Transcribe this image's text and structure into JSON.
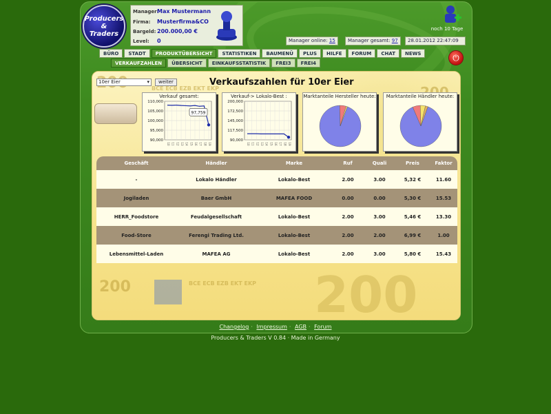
{
  "logo": {
    "line1": "Producers",
    "line2": "&",
    "line3": "Traders"
  },
  "manager": {
    "label_manager": "Manager:",
    "manager": "Max Mustermann",
    "label_firma": "Firma:",
    "firma": "Musterfirma&CO",
    "label_bargeld": "Bargeld:",
    "bargeld": "200.000,00 €",
    "label_level": "Level:",
    "level": "0"
  },
  "stats": {
    "online_label": "Manager online:",
    "online": "15",
    "total_label": "Manager gesamt:",
    "total": "97",
    "datetime": "28.01.2012 22:47:09"
  },
  "reward": {
    "label": "noch 10 Tage"
  },
  "nav": [
    "BÜRO",
    "STADT",
    "PRODUKTÜBERSICHT",
    "STATISTIKEN",
    "BAUMENÜ",
    "PLUS",
    "HILFE",
    "FORUM",
    "CHAT",
    "NEWS"
  ],
  "nav_active": 2,
  "subnav": [
    "VERKAUFZAHLEN",
    "ÜBERSICHT",
    "EINKAUFSSTATISTIK",
    "FREI3",
    "FREI4"
  ],
  "subnav_active": 0,
  "product_select": "10er Eier",
  "weiter": "weiter",
  "title": "Verkaufszahlen für 10er Eier",
  "banknote": {
    "denom": "200",
    "codes": "BCE ECB EZB EKT EKP"
  },
  "charts": {
    "c1_title": "Verkauf gesamt:",
    "c2_title": "Verkauf-> Lokalo-Best :",
    "c3_title": "Marktanteile Hersteller heute:",
    "c4_title": "Marktanteile Händler heute:",
    "tooltip": "97,759"
  },
  "chart_data": [
    {
      "type": "line",
      "title": "Verkauf gesamt:",
      "ylim": [
        90000,
        110000
      ],
      "yticks": [
        "110,000",
        "105,000",
        "100,000",
        "95,000",
        "90,000"
      ],
      "values": [
        108000,
        107900,
        108000,
        107800,
        107700,
        107600,
        107800,
        107400,
        107600,
        97759
      ],
      "x": [
        "10",
        "11",
        "12",
        "13",
        "14",
        "15",
        "16",
        "17",
        "18",
        "19"
      ]
    },
    {
      "type": "line",
      "title": "Verkauf-> Lokalo-Best :",
      "ylim": [
        90000,
        200000
      ],
      "yticks": [
        "200,000",
        "172,500",
        "145,000",
        "117,500",
        "90,000"
      ],
      "values": [
        107500,
        107500,
        107500,
        107000,
        107000,
        107000,
        107000,
        107000,
        107000,
        97500
      ],
      "x": [
        "10",
        "11",
        "12",
        "13",
        "14",
        "15",
        "16",
        "17",
        "18",
        "19"
      ]
    },
    {
      "type": "pie",
      "title": "Marktanteile Hersteller heute:",
      "values": [
        94,
        5,
        1
      ],
      "colors": [
        "#7f82e8",
        "#f07a7a",
        "#f5e26a"
      ]
    },
    {
      "type": "pie",
      "title": "Marktanteile Händler heute:",
      "values": [
        88,
        6,
        4,
        2
      ],
      "colors": [
        "#7f82e8",
        "#f07a7a",
        "#f5e26a",
        "#e0b060"
      ]
    }
  ],
  "table": {
    "headers": [
      "Geschäft",
      "Händler",
      "Marke",
      "Ruf",
      "Quali",
      "Preis",
      "Faktor"
    ],
    "rows": [
      [
        "-",
        "Lokalo Händler",
        "Lokalo-Best",
        "2.00",
        "3.00",
        "5,32 €",
        "11.60"
      ],
      [
        "Jogiladen",
        "Baer GmbH",
        "MAFEA FOOD",
        "0.00",
        "0.00",
        "5,30 €",
        "15.53"
      ],
      [
        "HERR_Foodstore",
        "Feudalgesellschaft",
        "Lokalo-Best",
        "2.00",
        "3.00",
        "5,46 €",
        "13.30"
      ],
      [
        "Food-Store",
        "Ferengi Trading Ltd.",
        "Lokalo-Best",
        "2.00",
        "2.00",
        "6,99 €",
        "1.00"
      ],
      [
        "Lebensmittel-Laden",
        "MAFEA AG",
        "Lokalo-Best",
        "2.00",
        "3.00",
        "5,80 €",
        "15.43"
      ]
    ]
  },
  "footer": {
    "links": [
      "Changelog",
      "Impressum",
      "AGB",
      "Forum"
    ],
    "version": "Producers & Traders V 0.84 · Made in Germany"
  }
}
